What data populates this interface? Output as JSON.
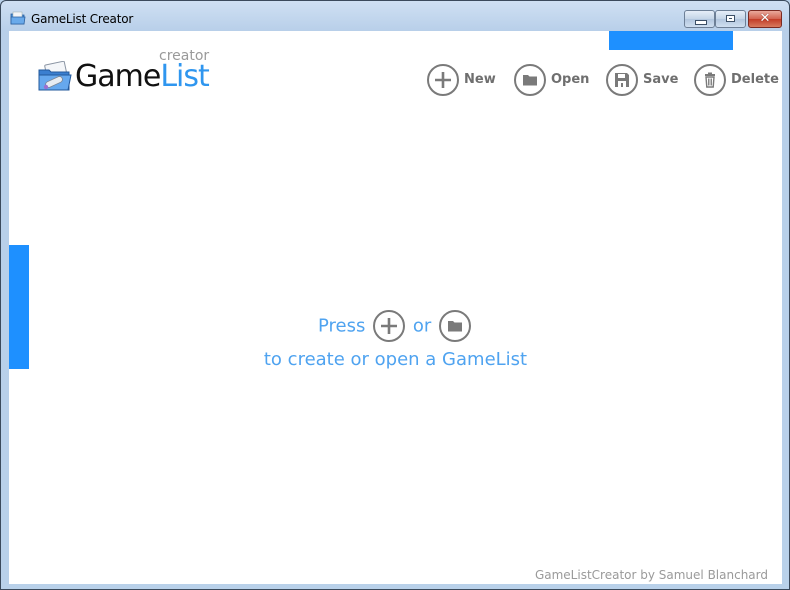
{
  "window": {
    "title": "GameList Creator",
    "controls": {
      "minimize": "minimize",
      "maximize": "maximize",
      "close": "✕"
    }
  },
  "logo": {
    "game": "Game",
    "list": "List",
    "creator": "creator"
  },
  "toolbar": {
    "items": [
      {
        "label": "New",
        "icon": "plus-icon"
      },
      {
        "label": "Open",
        "icon": "folder-icon"
      },
      {
        "label": "Save",
        "icon": "floppy-disk-icon"
      },
      {
        "label": "Delete",
        "icon": "trash-icon"
      }
    ]
  },
  "empty_state": {
    "press": "Press",
    "or": "or",
    "message": "to create or open a GameList"
  },
  "footer": {
    "credit": "GameListCreator by Samuel Blanchard"
  },
  "colors": {
    "accent": "#1e90ff",
    "logo_list": "#2f96ef",
    "hint_text": "#4fa3f0",
    "icon_gray": "#7a7a7a"
  }
}
